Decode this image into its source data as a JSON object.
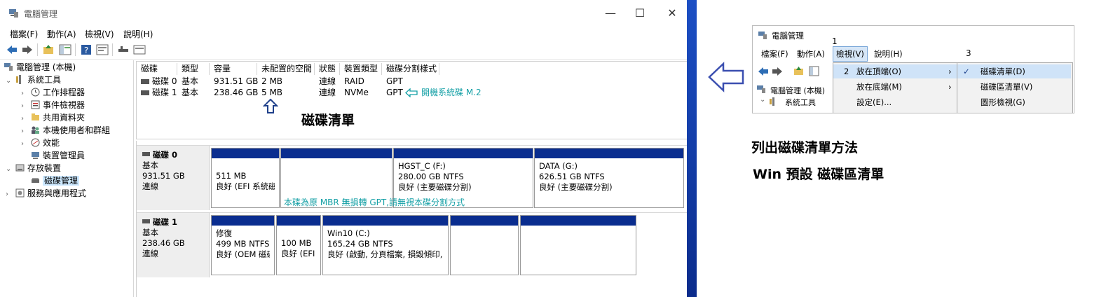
{
  "window": {
    "title": "電腦管理",
    "controls": {
      "minimize": "—",
      "maximize": "☐",
      "close": "✕"
    }
  },
  "menu": [
    "檔案(F)",
    "動作(A)",
    "檢視(V)",
    "說明(H)"
  ],
  "tree": {
    "root": "電腦管理 (本機)",
    "system_tools": "系統工具",
    "task_scheduler": "工作排程器",
    "event_viewer": "事件檢視器",
    "shared_folders": "共用資料夾",
    "local_users": "本機使用者和群組",
    "performance": "效能",
    "device_manager": "裝置管理員",
    "storage": "存放裝置",
    "disk_management": "磁碟管理",
    "services": "服務與應用程式"
  },
  "list": {
    "headers": [
      "磁碟",
      "類型",
      "容量",
      "未配置的空間",
      "狀態",
      "裝置類型",
      "磁碟分割樣式"
    ],
    "rows": [
      [
        "磁碟 0",
        "基本",
        "931.51 GB",
        "2 MB",
        "連線",
        "RAID",
        "GPT"
      ],
      [
        "磁碟 1",
        "基本",
        "238.46 GB",
        "5 MB",
        "連線",
        "NVMe",
        "GPT"
      ]
    ],
    "boot_note": "開機系統碟 M.2"
  },
  "graphical": {
    "disk0": {
      "name": "磁碟 0",
      "type": "基本",
      "size": "931.51 GB",
      "status": "連線",
      "partitions": [
        {
          "title": "",
          "size": "511 MB",
          "status": "良好 (EFI 系統磁"
        },
        {
          "title": "",
          "size": "",
          "status": ""
        },
        {
          "title": "HGST_C  (F:)",
          "size": "280.00 GB NTFS",
          "status": "良好 (主要磁碟分割)"
        },
        {
          "title": "DATA  (G:)",
          "size": "626.51 GB NTFS",
          "status": "良好 (主要磁碟分割)"
        }
      ],
      "note": "本碟為原 MBR 無損轉 GPT,請無視本碟分割方式"
    },
    "disk1": {
      "name": "磁碟 1",
      "type": "基本",
      "size": "238.46 GB",
      "status": "連線",
      "partitions": [
        {
          "title": "修復",
          "size": "499 MB NTFS",
          "status": "良好 (OEM 磁碟"
        },
        {
          "title": "",
          "size": "100 MB",
          "status": "良好 (EFI 系"
        },
        {
          "title": "Win10  (C:)",
          "size": "165.24 GB NTFS",
          "status": "良好 (啟動, 分頁檔案, 損毀傾印,"
        },
        {
          "title": "",
          "size": "",
          "status": ""
        },
        {
          "title": "",
          "size": "",
          "status": ""
        }
      ]
    }
  },
  "annotations": {
    "disk_list_label": "磁碟清單",
    "method_title": "列出磁碟清單方法",
    "default_note": "Win 預設 磁碟區清單",
    "step1": "1",
    "step2": "2",
    "step3": "3"
  },
  "mini": {
    "title": "電腦管理",
    "menu": [
      "檔案(F)",
      "動作(A)",
      "檢視(V)",
      "說明(H)"
    ],
    "tree_root": "電腦管理 (本機)",
    "tree_system_tools": "系統工具",
    "view_menu": [
      "放在頂端(O)",
      "放在底端(M)",
      "設定(E)..."
    ],
    "submenu": [
      "磁碟清單(D)",
      "磁碟區清單(V)",
      "圖形檢視(G)"
    ]
  },
  "colors": {
    "partition_bar": "#0a2d8f",
    "annotation": "#15a0a6",
    "selection": "#cce8ff"
  }
}
